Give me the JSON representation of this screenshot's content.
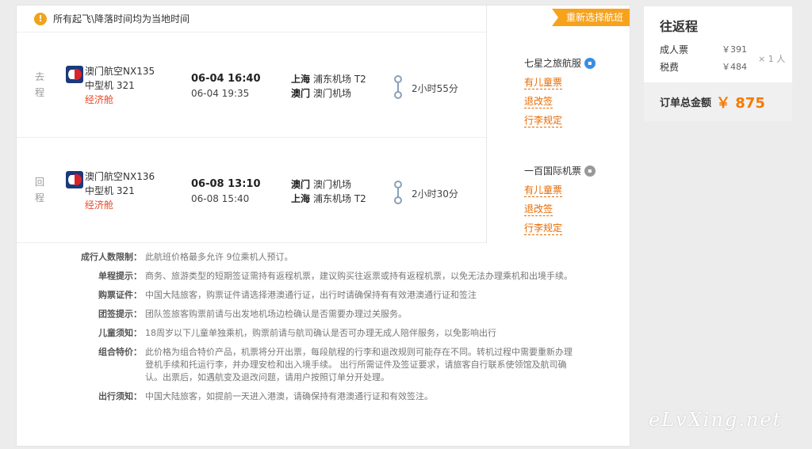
{
  "notice": {
    "text": "所有起飞\\降落时间均为当地时间"
  },
  "reselect_label": "重新选择航班",
  "outbound": {
    "tag": "去程",
    "flight": "澳门航空NX135",
    "aircraft": "中型机 321",
    "cabin": "经济舱",
    "dep_time": "06-04 16:40",
    "arr_time": "06-04 19:35",
    "dep_city": "上海",
    "dep_airport": "浦东机场 T2",
    "arr_city": "澳门",
    "arr_airport": "澳门机场",
    "duration": "2小时55分",
    "vendor": "七星之旅航服",
    "links": [
      "有儿童票",
      "退改签",
      "行李规定"
    ]
  },
  "return": {
    "tag": "回程",
    "flight": "澳门航空NX136",
    "aircraft": "中型机 321",
    "cabin": "经济舱",
    "dep_time": "06-08 13:10",
    "arr_time": "06-08 15:40",
    "dep_city": "澳门",
    "dep_airport": "澳门机场",
    "arr_city": "上海",
    "arr_airport": "浦东机场 T2",
    "duration": "2小时30分",
    "vendor": "一百国际机票",
    "links": [
      "有儿童票",
      "退改签",
      "行李规定"
    ]
  },
  "rules": [
    {
      "label": "成行人数限制：",
      "text": "此航班价格最多允许 9位乘机人预订。"
    },
    {
      "label": "单程提示：",
      "text": "商务、旅游类型的短期签证需持有返程机票，建议购买往返票或持有返程机票，以免无法办理乘机和出境手续。"
    },
    {
      "label": "购票证件：",
      "text": "中国大陆旅客，购票证件请选择港澳通行证，出行时请确保持有有效港澳通行证和签注"
    },
    {
      "label": "团签提示：",
      "text": "团队签旅客购票前请与出发地机场边检确认是否需要办理过关服务。"
    },
    {
      "label": "儿童须知：",
      "text": "18周岁以下儿童单独乘机，购票前请与航司确认是否可办理无成人陪伴服务，以免影响出行"
    },
    {
      "label": "组合特价：",
      "text": "此价格为组合特价产品，机票将分开出票，每段航程的行李和退改规则可能存在不同。转机过程中需要重新办理登机手续和托运行李，并办理安检和出入境手续。 出行所需证件及签证要求，请旅客自行联系使领馆及航司确认。出票后，如遇航变及退改问题，请用户按照订单分开处理。"
    },
    {
      "label": "出行须知：",
      "text": "中国大陆旅客，如提前一天进入港澳，请确保持有港澳通行证和有效签注。"
    }
  ],
  "summary": {
    "title": "往返程",
    "adult_label": "成人票",
    "adult_price": "￥391",
    "tax_label": "税费",
    "tax_price": "￥484",
    "multiplier": "× 1 人",
    "total_label": "订单总金额",
    "total_value": "￥ 875"
  },
  "watermark": "eLvXing.net",
  "colors": {
    "accent": "#f7a21c",
    "cabin": "#e8492b",
    "link": "#e86a00",
    "total": "#f57a00"
  }
}
